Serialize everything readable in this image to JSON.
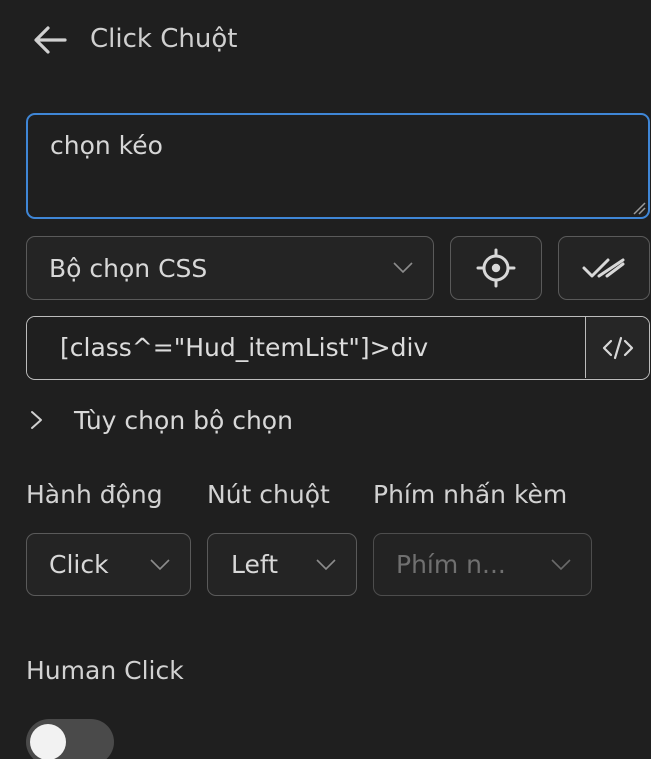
{
  "header": {
    "back_icon": "arrow-left-icon",
    "title": "Click Chuột"
  },
  "description": {
    "value": "chọn kéo"
  },
  "selector_type": {
    "selected": "Bộ chọn CSS",
    "pick_icon": "crosshair-icon",
    "verify_icon": "double-check-icon"
  },
  "selector": {
    "value": "[class^=\"Hud_itemList\"]>div",
    "code_icon": "code-icon"
  },
  "selector_options": {
    "label": "Tùy chọn bộ chọn",
    "icon": "chevron-right-icon"
  },
  "action": {
    "label": "Hành động",
    "selected": "Click"
  },
  "mouse_button": {
    "label": "Nút chuột",
    "selected": "Left"
  },
  "modifier": {
    "label": "Phím nhấn kèm",
    "placeholder": "Phím n..."
  },
  "human_click": {
    "label": "Human Click",
    "enabled": false
  },
  "colors": {
    "background": "#1f1f1f",
    "focus_border": "#3f86d6",
    "text": "#d8d8d8"
  }
}
